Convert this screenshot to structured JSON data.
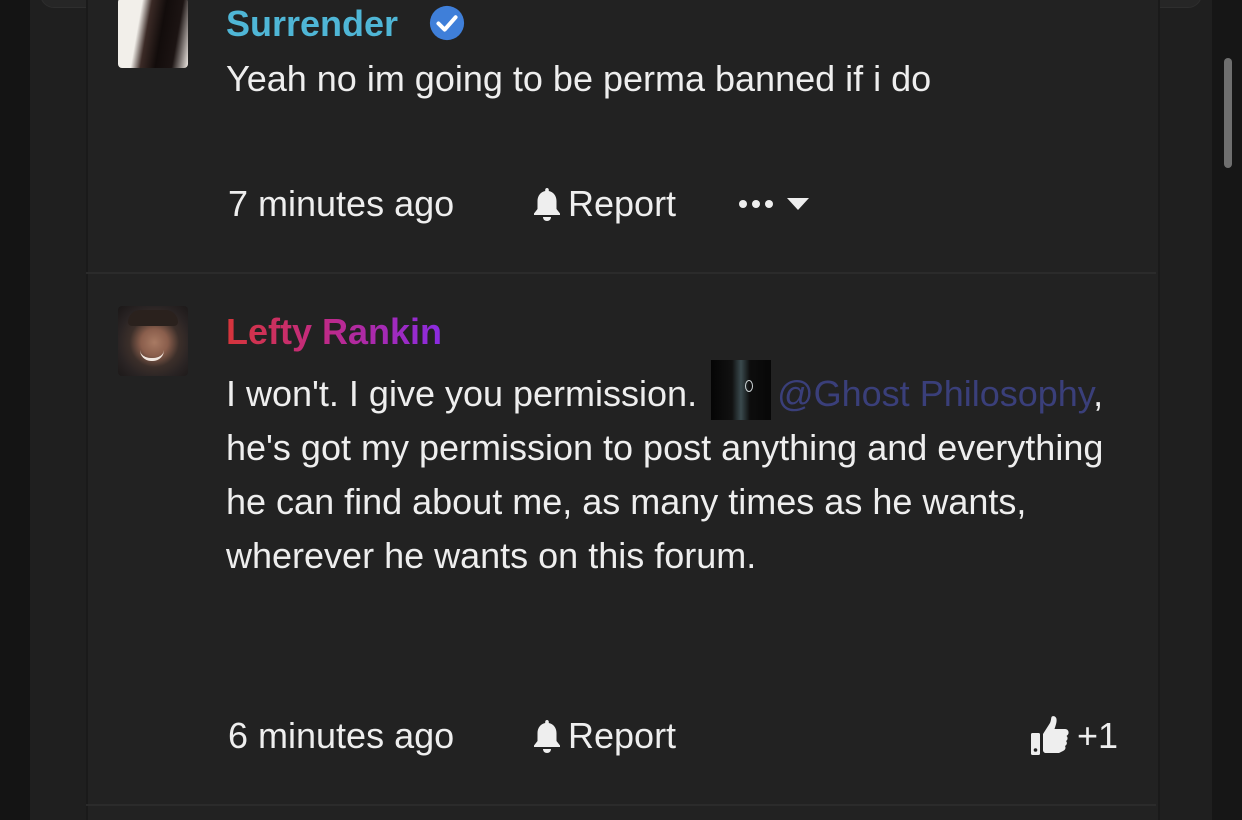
{
  "comments": [
    {
      "username": "Surrender",
      "verified": true,
      "body": "Yeah no im going to be perma banned if i do",
      "timestamp": "7 minutes ago",
      "report_label": "Report",
      "more_icon": "ellipsis-icon"
    },
    {
      "username": "Lefty Rankin",
      "body_before_mention": "I won't. I give you permission.",
      "mention": "@Ghost Philosophy",
      "body_after_mention": ", he's got my permission to post anything and everything he can find about me, as many times as he wants, wherever he wants on this forum.",
      "timestamp": "6 minutes ago",
      "report_label": "Report",
      "like_count": "+1"
    }
  ],
  "colors": {
    "background": "#222222",
    "text": "#eeeeee",
    "username_verified": "#4fb6d6",
    "verified_badge": "#3f7fd9",
    "mention_link": "#3a3f7a",
    "username_gradient": [
      "#d6353a",
      "#c02a86",
      "#8a2be2"
    ]
  }
}
